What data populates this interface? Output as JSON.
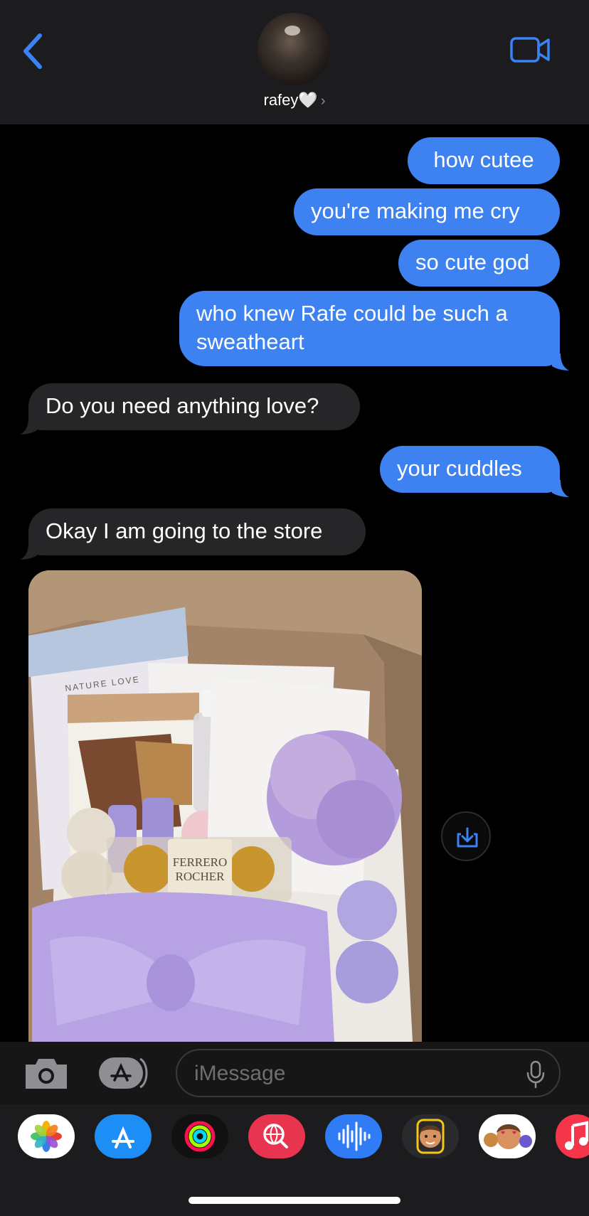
{
  "header": {
    "back_icon": "chevron-left-icon",
    "contact_name": "rafey🤍",
    "contact_chevron": "›",
    "facetime_icon": "video-camera-icon"
  },
  "messages": [
    {
      "direction": "sent",
      "text": "how cutee"
    },
    {
      "direction": "sent",
      "text": "you're making me cry"
    },
    {
      "direction": "sent",
      "text": "so cute god"
    },
    {
      "direction": "sent",
      "lines": [
        "who knew Rafe could be such a",
        "sweatheart"
      ]
    },
    {
      "direction": "received",
      "text": "Do you need anything love?"
    },
    {
      "direction": "sent",
      "text": "your cuddles"
    },
    {
      "direction": "received",
      "text": "Okay I am going to the store"
    },
    {
      "direction": "received",
      "type": "photo",
      "brand_text": [
        "NATURE LOVE",
        "FERRERO",
        "ROCHER"
      ]
    }
  ],
  "photo_actions": {
    "save_icon": "download-icon"
  },
  "compose": {
    "camera_icon": "camera-icon",
    "apps_icon": "app-store-icon",
    "placeholder": "iMessage",
    "mic_icon": "microphone-icon"
  },
  "app_drawer": [
    {
      "name": "photos-app-icon"
    },
    {
      "name": "app-store-app-icon"
    },
    {
      "name": "activity-app-icon"
    },
    {
      "name": "images-search-app-icon"
    },
    {
      "name": "audio-message-app-icon"
    },
    {
      "name": "memoji-app-icon"
    },
    {
      "name": "memoji-stickers-app-icon"
    },
    {
      "name": "music-app-icon"
    }
  ],
  "colors": {
    "sent_bubble": "#3d82f0",
    "received_bubble": "#262628",
    "accent": "#3b82f6",
    "background": "#000000"
  }
}
